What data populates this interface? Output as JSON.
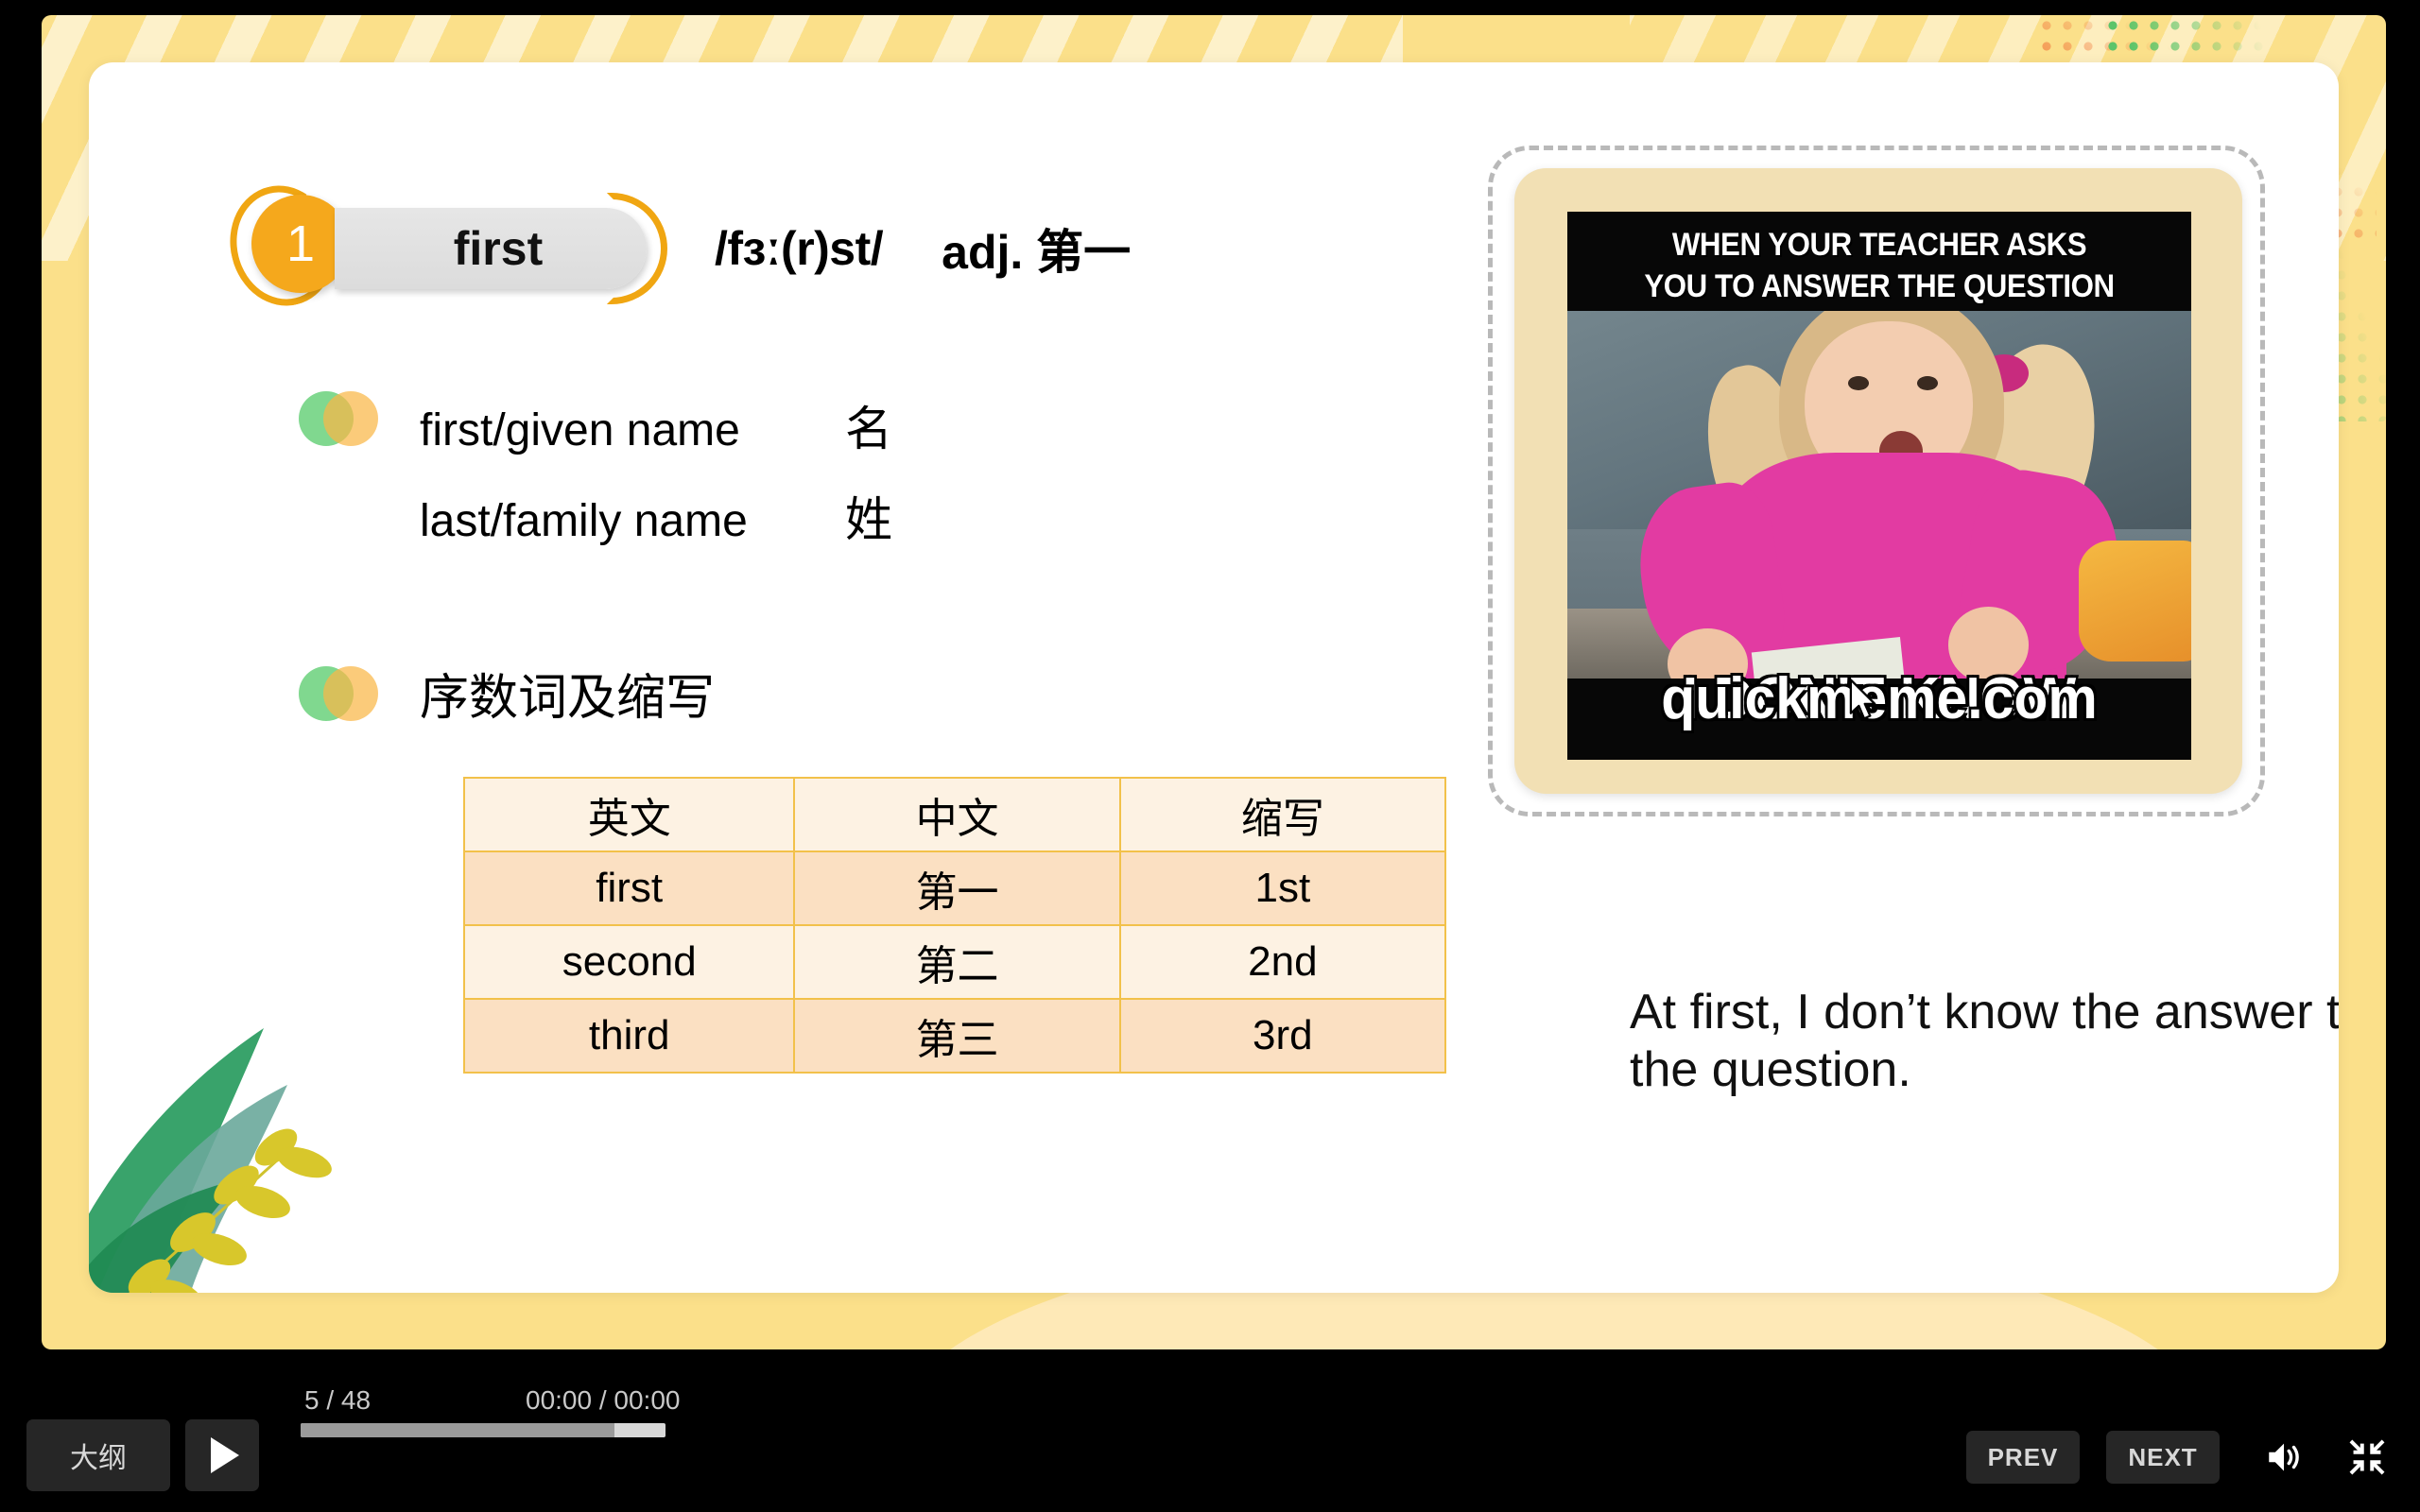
{
  "slide": {
    "number_badge": "1",
    "word": "first",
    "phonetic": "/fɜː(r)st/",
    "part_of_speech": "adj. 第一",
    "bullet1": {
      "rows": [
        {
          "en": "first/given name",
          "cn": "名"
        },
        {
          "en": "last/family name",
          "cn": "姓"
        }
      ]
    },
    "bullet2": {
      "heading": "序数词及缩写",
      "table": {
        "headers": [
          "英文",
          "中文",
          "缩写"
        ],
        "rows": [
          [
            "first",
            "第一",
            "1st"
          ],
          [
            "second",
            "第二",
            "2nd"
          ],
          [
            "third",
            "第三",
            "3rd"
          ]
        ]
      }
    },
    "meme": {
      "top_line1": "WHEN YOUR TEACHER ASKS",
      "top_line2": "YOU TO ANSWER THE QUESTION",
      "bottom_text": "I DON'T KNOW",
      "watermark": "quickmeme.com"
    },
    "sentence": "At first, I don’t know the answer to the question."
  },
  "player": {
    "outline_label": "大纲",
    "slide_counter": "5 / 48",
    "time_display": "00:00 / 00:00",
    "progress_percent": 86,
    "prev_label": "PREV",
    "next_label": "NEXT"
  },
  "colors": {
    "frame_yellow": "#fbe08a",
    "badge_orange": "#f5a81c",
    "table_border": "#f2c14a",
    "table_row_odd": "#fbe0c2",
    "table_row_even": "#fdf2e3",
    "meme_card": "#f2e0b4"
  }
}
